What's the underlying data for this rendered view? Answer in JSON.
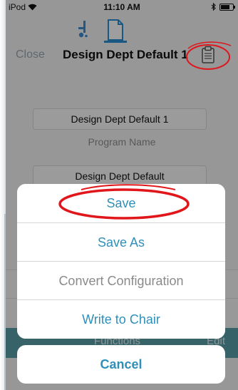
{
  "status_bar": {
    "carrier": "iPod",
    "time": "11:10 AM",
    "battery_level": 0.75
  },
  "nav": {
    "close_label": "Close",
    "title": "Design Dept Default 1"
  },
  "form": {
    "program_name_value": "Design Dept Default 1",
    "program_name_caption": "Program Name",
    "second_field_value": "Design Dept Default"
  },
  "background": {
    "section_label": "Functions",
    "edit_label": "Edit"
  },
  "action_sheet": {
    "items": [
      {
        "label": "Save"
      },
      {
        "label": "Save As"
      },
      {
        "label": "Convert Configuration"
      },
      {
        "label": "Write to Chair"
      }
    ],
    "cancel_label": "Cancel"
  },
  "colors": {
    "accent": "#2f8fb8",
    "annotation": "#e0161b",
    "teal_bar": "#5aa1a8"
  },
  "icons": [
    "wifi-icon",
    "bluetooth-icon",
    "battery-icon",
    "wheelchair-icon",
    "document-icon",
    "clipboard-icon"
  ]
}
